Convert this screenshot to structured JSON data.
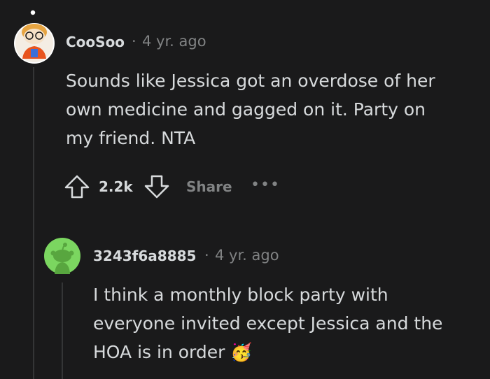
{
  "comment": {
    "author": "CooSoo",
    "age": "4 yr. ago",
    "body": [
      "Sounds like Jessica got an overdose of her",
      "own medicine and gagged on it. Party on",
      "my friend. NTA"
    ],
    "votes": "2.2k",
    "share_label": "Share",
    "more_label": "•••"
  },
  "reply": {
    "author": "3243f6a8885",
    "age": "4 yr. ago",
    "body": [
      "I think a monthly block party with",
      "everyone invited except Jessica and the",
      "HOA is in order"
    ],
    "emoji": "🥳"
  },
  "colors": {
    "background": "#1a1a1b",
    "text": "#d7dadc",
    "muted": "#818384",
    "thread_line": "#343536",
    "reply_avatar_green": "#7bd660"
  }
}
